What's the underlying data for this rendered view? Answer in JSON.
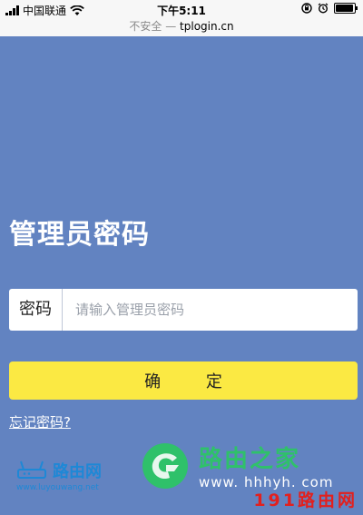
{
  "status": {
    "carrier": "中国联通",
    "time": "下午5:11"
  },
  "url_bar": {
    "insecure": "不安全 —",
    "domain": "tplogin.cn"
  },
  "page": {
    "title": "管理员密码",
    "password_label": "密码",
    "password_placeholder": "请输入管理员密码",
    "password_value": "",
    "confirm_label": "确 定",
    "forgot_label": "忘记密码?"
  },
  "watermarks": {
    "site1_name": "路由网",
    "site1_url": "www.luyouwang.net",
    "site2_name": "路由之家",
    "site2_url": "www. hhhyh. com",
    "site3_name": "191路由网"
  },
  "colors": {
    "background": "#6283c1",
    "button": "#fbe943",
    "status_bar": "#f7f7f7"
  },
  "icons": [
    "signal-icon",
    "wifi-icon",
    "rotation-lock-icon",
    "alarm-icon",
    "battery-icon"
  ]
}
